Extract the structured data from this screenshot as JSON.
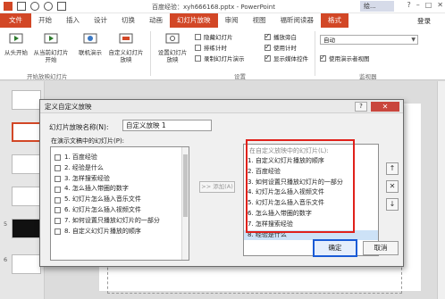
{
  "title_bar": {
    "title": "百度经验：xyh666168.pptx - PowerPoint",
    "help_badge": "绘..."
  },
  "tabs": [
    "文件",
    "开始",
    "插入",
    "设计",
    "切换",
    "动画",
    "幻灯片放映",
    "审阅",
    "视图",
    "福昕阅读器",
    "格式"
  ],
  "active_tab": "幻灯片放映",
  "login": "登录",
  "ribbon": {
    "from_start": "从头开始",
    "from_current": "从当前幻灯片开始",
    "online": "联机演示",
    "custom": "自定义幻灯片放映",
    "group_start": "开始放映幻灯片",
    "setup": "设置幻灯片放映",
    "hide": "隐藏幻灯片",
    "rehearse": "排练计时",
    "record": "录制幻灯片演示",
    "play_narration": "播放旁白",
    "use_timing": "使用计时",
    "show_media": "显示媒体控件",
    "group_setup": "设置",
    "resolution": "自动",
    "presenter_view": "使用演示者视图",
    "group_monitor": "监视器"
  },
  "thumb_numbers": [
    "5",
    "6"
  ],
  "dialog": {
    "title": "定义自定义放映",
    "help": "?",
    "close": "✕",
    "name_label": "幻灯片放映名称(N):",
    "name_value": "自定义放映 1",
    "available_label": "在演示文稿中的幻灯片(P):",
    "custom_label": "在自定义放映中的幻灯片(L):",
    "available_slides": [
      "1. 百度经验",
      "2. 经验是什么",
      "3. 怎样搜索经验",
      "4. 怎么插入带圈的数字",
      "5. 幻灯片怎么插入音乐文件",
      "6. 幻灯片怎么插入视频文件",
      "7. 如何设置只播放幻灯片的一部分",
      "8. 自定义幻灯片播放的顺序"
    ],
    "custom_slides": [
      "1. 自定义幻灯片播放的顺序",
      "2. 百度经验",
      "3. 如何设置只播放幻灯片的一部分",
      "4. 幻灯片怎么插入视频文件",
      "5. 幻灯片怎么插入音乐文件",
      "6. 怎么插入带圈的数字",
      "7. 怎样搜索经验",
      "8. 经验是什么"
    ],
    "add_button": ">> 添加(A)",
    "up_icon": "↑",
    "delete_icon": "✕",
    "down_icon": "↓",
    "ok": "确定",
    "cancel": "取消"
  },
  "colors": {
    "accent": "#d24726",
    "highlight_box": "#e0211b",
    "ok_border": "#1a5bd6"
  }
}
